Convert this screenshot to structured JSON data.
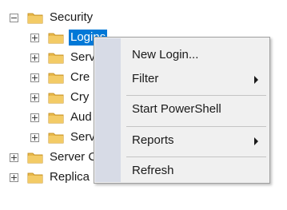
{
  "tree": {
    "security": {
      "label": "Security",
      "expanded": true,
      "icon": "folder-icon"
    },
    "children": [
      {
        "label": "Logins",
        "selected": true
      },
      {
        "label": "Serv"
      },
      {
        "label": "Cre"
      },
      {
        "label": "Cry"
      },
      {
        "label": "Aud"
      },
      {
        "label": "Serv"
      }
    ],
    "siblings": [
      {
        "label": "Server C"
      },
      {
        "label": "Replica"
      }
    ]
  },
  "context_menu": {
    "items": [
      {
        "label": "New Login...",
        "submenu": false
      },
      {
        "label": "Filter",
        "submenu": true
      },
      {
        "label": "Start PowerShell",
        "submenu": false
      },
      {
        "label": "Reports",
        "submenu": true
      },
      {
        "label": "Refresh",
        "submenu": false
      }
    ]
  },
  "colors": {
    "selection": "#0078d7",
    "folder": "#e8b84a",
    "menu_background": "#f0f0f0",
    "menu_gutter": "#d7dbe6"
  }
}
